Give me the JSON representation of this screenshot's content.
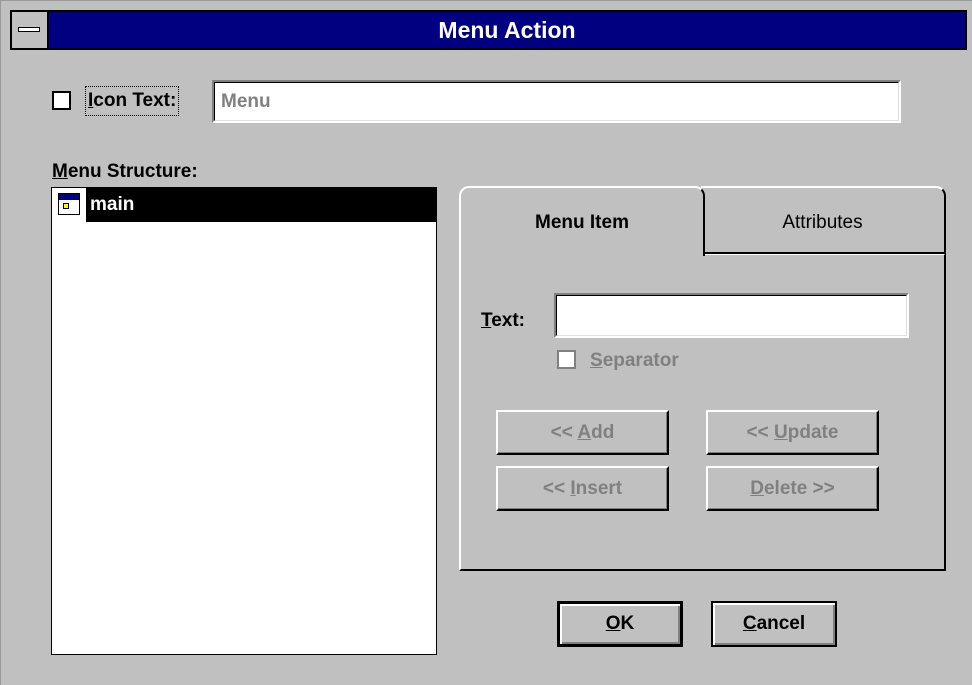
{
  "window": {
    "title": "Menu Action"
  },
  "icon_text": {
    "checkbox_checked": false,
    "label_mnemonic": "I",
    "label_rest": "con Text:",
    "value": "Menu"
  },
  "menu_structure": {
    "label_mnemonic": "M",
    "label_rest": "enu Structure:",
    "items": [
      {
        "label": "main",
        "icon": "menu-window-icon",
        "selected": true
      }
    ]
  },
  "tabs": [
    {
      "label": "Menu Item",
      "active": true
    },
    {
      "label": "Attributes",
      "active": false
    }
  ],
  "menu_item": {
    "text_label_mnemonic": "T",
    "text_label_rest": "ext:",
    "text_value": "",
    "separator_mnemonic": "S",
    "separator_rest": "eparator",
    "separator_checked": false
  },
  "buttons": {
    "add_prefix": "<< ",
    "add_mnemonic": "A",
    "add_rest": "dd",
    "update_prefix": "<< ",
    "update_mnemonic": "U",
    "update_rest": "pdate",
    "insert_prefix": "<< ",
    "insert_mnemonic": "I",
    "insert_rest": "nsert",
    "delete_mnemonic": "D",
    "delete_rest": "elete >>",
    "ok_mnemonic": "O",
    "ok_rest": "K",
    "cancel_mnemonic": "C",
    "cancel_rest": "ancel"
  },
  "colors": {
    "face": "#c0c0c0",
    "titlebar": "#000080",
    "selection": "#000000",
    "disabled_text": "#808080"
  }
}
